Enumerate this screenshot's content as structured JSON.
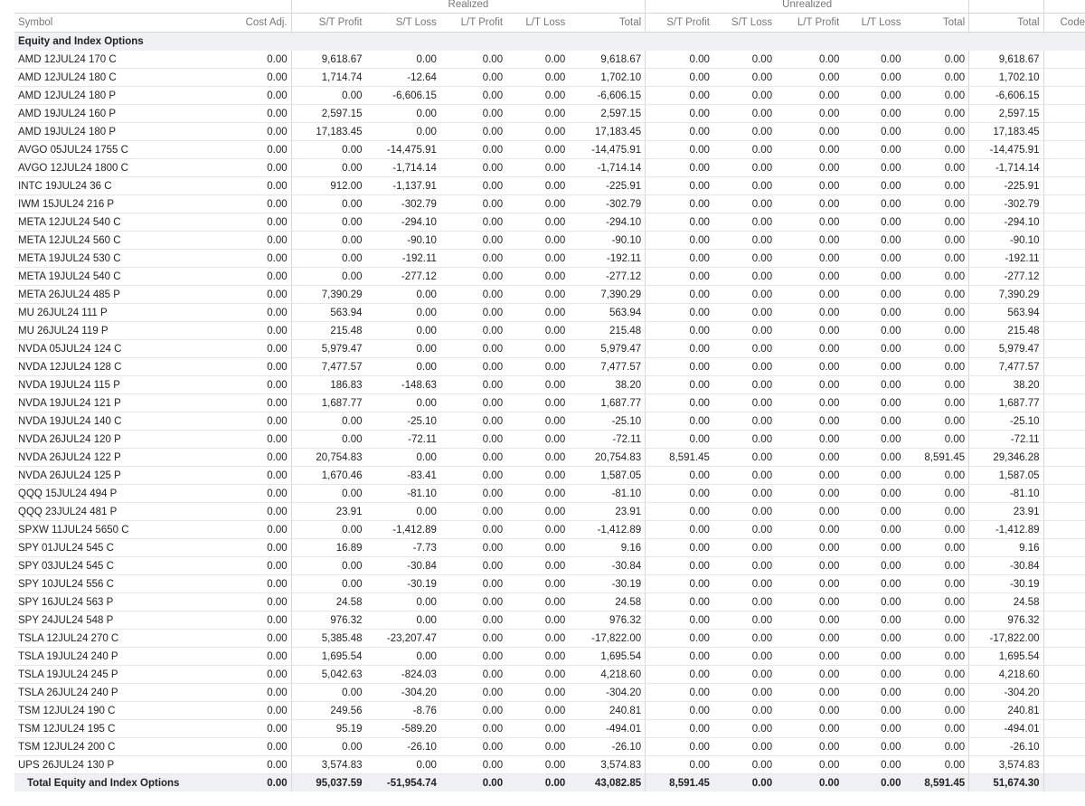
{
  "header": {
    "groups": {
      "realized": "Realized",
      "unrealized": "Unrealized"
    },
    "columns": {
      "symbol": "Symbol",
      "cost_adj": "Cost Adj.",
      "r_st_profit": "S/T Profit",
      "r_st_loss": "S/T Loss",
      "r_lt_profit": "L/T Profit",
      "r_lt_loss": "L/T Loss",
      "r_total": "Total",
      "u_st_profit": "S/T Profit",
      "u_st_loss": "S/T Loss",
      "u_lt_profit": "L/T Profit",
      "u_lt_loss": "L/T Loss",
      "u_total": "Total",
      "total": "Total",
      "code": "Code"
    }
  },
  "section": {
    "title": "Equity and Index Options"
  },
  "rows": [
    {
      "symbol": "AMD 12JUL24 170 C",
      "cost_adj": "0.00",
      "r_st_profit": "9,618.67",
      "r_st_loss": "0.00",
      "r_lt_profit": "0.00",
      "r_lt_loss": "0.00",
      "r_total": "9,618.67",
      "u_st_profit": "0.00",
      "u_st_loss": "0.00",
      "u_lt_profit": "0.00",
      "u_lt_loss": "0.00",
      "u_total": "0.00",
      "total": "9,618.67",
      "code": ""
    },
    {
      "symbol": "AMD 12JUL24 180 C",
      "cost_adj": "0.00",
      "r_st_profit": "1,714.74",
      "r_st_loss": "-12.64",
      "r_lt_profit": "0.00",
      "r_lt_loss": "0.00",
      "r_total": "1,702.10",
      "u_st_profit": "0.00",
      "u_st_loss": "0.00",
      "u_lt_profit": "0.00",
      "u_lt_loss": "0.00",
      "u_total": "0.00",
      "total": "1,702.10",
      "code": ""
    },
    {
      "symbol": "AMD 12JUL24 180 P",
      "cost_adj": "0.00",
      "r_st_profit": "0.00",
      "r_st_loss": "-6,606.15",
      "r_lt_profit": "0.00",
      "r_lt_loss": "0.00",
      "r_total": "-6,606.15",
      "u_st_profit": "0.00",
      "u_st_loss": "0.00",
      "u_lt_profit": "0.00",
      "u_lt_loss": "0.00",
      "u_total": "0.00",
      "total": "-6,606.15",
      "code": ""
    },
    {
      "symbol": "AMD 19JUL24 160 P",
      "cost_adj": "0.00",
      "r_st_profit": "2,597.15",
      "r_st_loss": "0.00",
      "r_lt_profit": "0.00",
      "r_lt_loss": "0.00",
      "r_total": "2,597.15",
      "u_st_profit": "0.00",
      "u_st_loss": "0.00",
      "u_lt_profit": "0.00",
      "u_lt_loss": "0.00",
      "u_total": "0.00",
      "total": "2,597.15",
      "code": ""
    },
    {
      "symbol": "AMD 19JUL24 180 P",
      "cost_adj": "0.00",
      "r_st_profit": "17,183.45",
      "r_st_loss": "0.00",
      "r_lt_profit": "0.00",
      "r_lt_loss": "0.00",
      "r_total": "17,183.45",
      "u_st_profit": "0.00",
      "u_st_loss": "0.00",
      "u_lt_profit": "0.00",
      "u_lt_loss": "0.00",
      "u_total": "0.00",
      "total": "17,183.45",
      "code": ""
    },
    {
      "symbol": "AVGO 05JUL24 1755 C",
      "cost_adj": "0.00",
      "r_st_profit": "0.00",
      "r_st_loss": "-14,475.91",
      "r_lt_profit": "0.00",
      "r_lt_loss": "0.00",
      "r_total": "-14,475.91",
      "u_st_profit": "0.00",
      "u_st_loss": "0.00",
      "u_lt_profit": "0.00",
      "u_lt_loss": "0.00",
      "u_total": "0.00",
      "total": "-14,475.91",
      "code": ""
    },
    {
      "symbol": "AVGO 12JUL24 1800 C",
      "cost_adj": "0.00",
      "r_st_profit": "0.00",
      "r_st_loss": "-1,714.14",
      "r_lt_profit": "0.00",
      "r_lt_loss": "0.00",
      "r_total": "-1,714.14",
      "u_st_profit": "0.00",
      "u_st_loss": "0.00",
      "u_lt_profit": "0.00",
      "u_lt_loss": "0.00",
      "u_total": "0.00",
      "total": "-1,714.14",
      "code": ""
    },
    {
      "symbol": "INTC 19JUL24 36 C",
      "cost_adj": "0.00",
      "r_st_profit": "912.00",
      "r_st_loss": "-1,137.91",
      "r_lt_profit": "0.00",
      "r_lt_loss": "0.00",
      "r_total": "-225.91",
      "u_st_profit": "0.00",
      "u_st_loss": "0.00",
      "u_lt_profit": "0.00",
      "u_lt_loss": "0.00",
      "u_total": "0.00",
      "total": "-225.91",
      "code": ""
    },
    {
      "symbol": "IWM 15JUL24 216 P",
      "cost_adj": "0.00",
      "r_st_profit": "0.00",
      "r_st_loss": "-302.79",
      "r_lt_profit": "0.00",
      "r_lt_loss": "0.00",
      "r_total": "-302.79",
      "u_st_profit": "0.00",
      "u_st_loss": "0.00",
      "u_lt_profit": "0.00",
      "u_lt_loss": "0.00",
      "u_total": "0.00",
      "total": "-302.79",
      "code": ""
    },
    {
      "symbol": "META 12JUL24 540 C",
      "cost_adj": "0.00",
      "r_st_profit": "0.00",
      "r_st_loss": "-294.10",
      "r_lt_profit": "0.00",
      "r_lt_loss": "0.00",
      "r_total": "-294.10",
      "u_st_profit": "0.00",
      "u_st_loss": "0.00",
      "u_lt_profit": "0.00",
      "u_lt_loss": "0.00",
      "u_total": "0.00",
      "total": "-294.10",
      "code": ""
    },
    {
      "symbol": "META 12JUL24 560 C",
      "cost_adj": "0.00",
      "r_st_profit": "0.00",
      "r_st_loss": "-90.10",
      "r_lt_profit": "0.00",
      "r_lt_loss": "0.00",
      "r_total": "-90.10",
      "u_st_profit": "0.00",
      "u_st_loss": "0.00",
      "u_lt_profit": "0.00",
      "u_lt_loss": "0.00",
      "u_total": "0.00",
      "total": "-90.10",
      "code": ""
    },
    {
      "symbol": "META 19JUL24 530 C",
      "cost_adj": "0.00",
      "r_st_profit": "0.00",
      "r_st_loss": "-192.11",
      "r_lt_profit": "0.00",
      "r_lt_loss": "0.00",
      "r_total": "-192.11",
      "u_st_profit": "0.00",
      "u_st_loss": "0.00",
      "u_lt_profit": "0.00",
      "u_lt_loss": "0.00",
      "u_total": "0.00",
      "total": "-192.11",
      "code": ""
    },
    {
      "symbol": "META 19JUL24 540 C",
      "cost_adj": "0.00",
      "r_st_profit": "0.00",
      "r_st_loss": "-277.12",
      "r_lt_profit": "0.00",
      "r_lt_loss": "0.00",
      "r_total": "-277.12",
      "u_st_profit": "0.00",
      "u_st_loss": "0.00",
      "u_lt_profit": "0.00",
      "u_lt_loss": "0.00",
      "u_total": "0.00",
      "total": "-277.12",
      "code": ""
    },
    {
      "symbol": "META 26JUL24 485 P",
      "cost_adj": "0.00",
      "r_st_profit": "7,390.29",
      "r_st_loss": "0.00",
      "r_lt_profit": "0.00",
      "r_lt_loss": "0.00",
      "r_total": "7,390.29",
      "u_st_profit": "0.00",
      "u_st_loss": "0.00",
      "u_lt_profit": "0.00",
      "u_lt_loss": "0.00",
      "u_total": "0.00",
      "total": "7,390.29",
      "code": ""
    },
    {
      "symbol": "MU 26JUL24 111 P",
      "cost_adj": "0.00",
      "r_st_profit": "563.94",
      "r_st_loss": "0.00",
      "r_lt_profit": "0.00",
      "r_lt_loss": "0.00",
      "r_total": "563.94",
      "u_st_profit": "0.00",
      "u_st_loss": "0.00",
      "u_lt_profit": "0.00",
      "u_lt_loss": "0.00",
      "u_total": "0.00",
      "total": "563.94",
      "code": ""
    },
    {
      "symbol": "MU 26JUL24 119 P",
      "cost_adj": "0.00",
      "r_st_profit": "215.48",
      "r_st_loss": "0.00",
      "r_lt_profit": "0.00",
      "r_lt_loss": "0.00",
      "r_total": "215.48",
      "u_st_profit": "0.00",
      "u_st_loss": "0.00",
      "u_lt_profit": "0.00",
      "u_lt_loss": "0.00",
      "u_total": "0.00",
      "total": "215.48",
      "code": ""
    },
    {
      "symbol": "NVDA 05JUL24 124 C",
      "cost_adj": "0.00",
      "r_st_profit": "5,979.47",
      "r_st_loss": "0.00",
      "r_lt_profit": "0.00",
      "r_lt_loss": "0.00",
      "r_total": "5,979.47",
      "u_st_profit": "0.00",
      "u_st_loss": "0.00",
      "u_lt_profit": "0.00",
      "u_lt_loss": "0.00",
      "u_total": "0.00",
      "total": "5,979.47",
      "code": ""
    },
    {
      "symbol": "NVDA 12JUL24 128 C",
      "cost_adj": "0.00",
      "r_st_profit": "7,477.57",
      "r_st_loss": "0.00",
      "r_lt_profit": "0.00",
      "r_lt_loss": "0.00",
      "r_total": "7,477.57",
      "u_st_profit": "0.00",
      "u_st_loss": "0.00",
      "u_lt_profit": "0.00",
      "u_lt_loss": "0.00",
      "u_total": "0.00",
      "total": "7,477.57",
      "code": ""
    },
    {
      "symbol": "NVDA 19JUL24 115 P",
      "cost_adj": "0.00",
      "r_st_profit": "186.83",
      "r_st_loss": "-148.63",
      "r_lt_profit": "0.00",
      "r_lt_loss": "0.00",
      "r_total": "38.20",
      "u_st_profit": "0.00",
      "u_st_loss": "0.00",
      "u_lt_profit": "0.00",
      "u_lt_loss": "0.00",
      "u_total": "0.00",
      "total": "38.20",
      "code": ""
    },
    {
      "symbol": "NVDA 19JUL24 121 P",
      "cost_adj": "0.00",
      "r_st_profit": "1,687.77",
      "r_st_loss": "0.00",
      "r_lt_profit": "0.00",
      "r_lt_loss": "0.00",
      "r_total": "1,687.77",
      "u_st_profit": "0.00",
      "u_st_loss": "0.00",
      "u_lt_profit": "0.00",
      "u_lt_loss": "0.00",
      "u_total": "0.00",
      "total": "1,687.77",
      "code": ""
    },
    {
      "symbol": "NVDA 19JUL24 140 C",
      "cost_adj": "0.00",
      "r_st_profit": "0.00",
      "r_st_loss": "-25.10",
      "r_lt_profit": "0.00",
      "r_lt_loss": "0.00",
      "r_total": "-25.10",
      "u_st_profit": "0.00",
      "u_st_loss": "0.00",
      "u_lt_profit": "0.00",
      "u_lt_loss": "0.00",
      "u_total": "0.00",
      "total": "-25.10",
      "code": ""
    },
    {
      "symbol": "NVDA 26JUL24 120 P",
      "cost_adj": "0.00",
      "r_st_profit": "0.00",
      "r_st_loss": "-72.11",
      "r_lt_profit": "0.00",
      "r_lt_loss": "0.00",
      "r_total": "-72.11",
      "u_st_profit": "0.00",
      "u_st_loss": "0.00",
      "u_lt_profit": "0.00",
      "u_lt_loss": "0.00",
      "u_total": "0.00",
      "total": "-72.11",
      "code": ""
    },
    {
      "symbol": "NVDA 26JUL24 122 P",
      "cost_adj": "0.00",
      "r_st_profit": "20,754.83",
      "r_st_loss": "0.00",
      "r_lt_profit": "0.00",
      "r_lt_loss": "0.00",
      "r_total": "20,754.83",
      "u_st_profit": "8,591.45",
      "u_st_loss": "0.00",
      "u_lt_profit": "0.00",
      "u_lt_loss": "0.00",
      "u_total": "8,591.45",
      "total": "29,346.28",
      "code": ""
    },
    {
      "symbol": "NVDA 26JUL24 125 P",
      "cost_adj": "0.00",
      "r_st_profit": "1,670.46",
      "r_st_loss": "-83.41",
      "r_lt_profit": "0.00",
      "r_lt_loss": "0.00",
      "r_total": "1,587.05",
      "u_st_profit": "0.00",
      "u_st_loss": "0.00",
      "u_lt_profit": "0.00",
      "u_lt_loss": "0.00",
      "u_total": "0.00",
      "total": "1,587.05",
      "code": ""
    },
    {
      "symbol": "QQQ 15JUL24 494 P",
      "cost_adj": "0.00",
      "r_st_profit": "0.00",
      "r_st_loss": "-81.10",
      "r_lt_profit": "0.00",
      "r_lt_loss": "0.00",
      "r_total": "-81.10",
      "u_st_profit": "0.00",
      "u_st_loss": "0.00",
      "u_lt_profit": "0.00",
      "u_lt_loss": "0.00",
      "u_total": "0.00",
      "total": "-81.10",
      "code": ""
    },
    {
      "symbol": "QQQ 23JUL24 481 P",
      "cost_adj": "0.00",
      "r_st_profit": "23.91",
      "r_st_loss": "0.00",
      "r_lt_profit": "0.00",
      "r_lt_loss": "0.00",
      "r_total": "23.91",
      "u_st_profit": "0.00",
      "u_st_loss": "0.00",
      "u_lt_profit": "0.00",
      "u_lt_loss": "0.00",
      "u_total": "0.00",
      "total": "23.91",
      "code": ""
    },
    {
      "symbol": "SPXW 11JUL24 5650 C",
      "cost_adj": "0.00",
      "r_st_profit": "0.00",
      "r_st_loss": "-1,412.89",
      "r_lt_profit": "0.00",
      "r_lt_loss": "0.00",
      "r_total": "-1,412.89",
      "u_st_profit": "0.00",
      "u_st_loss": "0.00",
      "u_lt_profit": "0.00",
      "u_lt_loss": "0.00",
      "u_total": "0.00",
      "total": "-1,412.89",
      "code": ""
    },
    {
      "symbol": "SPY 01JUL24 545 C",
      "cost_adj": "0.00",
      "r_st_profit": "16.89",
      "r_st_loss": "-7.73",
      "r_lt_profit": "0.00",
      "r_lt_loss": "0.00",
      "r_total": "9.16",
      "u_st_profit": "0.00",
      "u_st_loss": "0.00",
      "u_lt_profit": "0.00",
      "u_lt_loss": "0.00",
      "u_total": "0.00",
      "total": "9.16",
      "code": ""
    },
    {
      "symbol": "SPY 03JUL24 545 C",
      "cost_adj": "0.00",
      "r_st_profit": "0.00",
      "r_st_loss": "-30.84",
      "r_lt_profit": "0.00",
      "r_lt_loss": "0.00",
      "r_total": "-30.84",
      "u_st_profit": "0.00",
      "u_st_loss": "0.00",
      "u_lt_profit": "0.00",
      "u_lt_loss": "0.00",
      "u_total": "0.00",
      "total": "-30.84",
      "code": ""
    },
    {
      "symbol": "SPY 10JUL24 556 C",
      "cost_adj": "0.00",
      "r_st_profit": "0.00",
      "r_st_loss": "-30.19",
      "r_lt_profit": "0.00",
      "r_lt_loss": "0.00",
      "r_total": "-30.19",
      "u_st_profit": "0.00",
      "u_st_loss": "0.00",
      "u_lt_profit": "0.00",
      "u_lt_loss": "0.00",
      "u_total": "0.00",
      "total": "-30.19",
      "code": ""
    },
    {
      "symbol": "SPY 16JUL24 563 P",
      "cost_adj": "0.00",
      "r_st_profit": "24.58",
      "r_st_loss": "0.00",
      "r_lt_profit": "0.00",
      "r_lt_loss": "0.00",
      "r_total": "24.58",
      "u_st_profit": "0.00",
      "u_st_loss": "0.00",
      "u_lt_profit": "0.00",
      "u_lt_loss": "0.00",
      "u_total": "0.00",
      "total": "24.58",
      "code": ""
    },
    {
      "symbol": "SPY 24JUL24 548 P",
      "cost_adj": "0.00",
      "r_st_profit": "976.32",
      "r_st_loss": "0.00",
      "r_lt_profit": "0.00",
      "r_lt_loss": "0.00",
      "r_total": "976.32",
      "u_st_profit": "0.00",
      "u_st_loss": "0.00",
      "u_lt_profit": "0.00",
      "u_lt_loss": "0.00",
      "u_total": "0.00",
      "total": "976.32",
      "code": ""
    },
    {
      "symbol": "TSLA 12JUL24 270 C",
      "cost_adj": "0.00",
      "r_st_profit": "5,385.48",
      "r_st_loss": "-23,207.47",
      "r_lt_profit": "0.00",
      "r_lt_loss": "0.00",
      "r_total": "-17,822.00",
      "u_st_profit": "0.00",
      "u_st_loss": "0.00",
      "u_lt_profit": "0.00",
      "u_lt_loss": "0.00",
      "u_total": "0.00",
      "total": "-17,822.00",
      "code": ""
    },
    {
      "symbol": "TSLA 19JUL24 240 P",
      "cost_adj": "0.00",
      "r_st_profit": "1,695.54",
      "r_st_loss": "0.00",
      "r_lt_profit": "0.00",
      "r_lt_loss": "0.00",
      "r_total": "1,695.54",
      "u_st_profit": "0.00",
      "u_st_loss": "0.00",
      "u_lt_profit": "0.00",
      "u_lt_loss": "0.00",
      "u_total": "0.00",
      "total": "1,695.54",
      "code": ""
    },
    {
      "symbol": "TSLA 19JUL24 245 P",
      "cost_adj": "0.00",
      "r_st_profit": "5,042.63",
      "r_st_loss": "-824.03",
      "r_lt_profit": "0.00",
      "r_lt_loss": "0.00",
      "r_total": "4,218.60",
      "u_st_profit": "0.00",
      "u_st_loss": "0.00",
      "u_lt_profit": "0.00",
      "u_lt_loss": "0.00",
      "u_total": "0.00",
      "total": "4,218.60",
      "code": ""
    },
    {
      "symbol": "TSLA 26JUL24 240 P",
      "cost_adj": "0.00",
      "r_st_profit": "0.00",
      "r_st_loss": "-304.20",
      "r_lt_profit": "0.00",
      "r_lt_loss": "0.00",
      "r_total": "-304.20",
      "u_st_profit": "0.00",
      "u_st_loss": "0.00",
      "u_lt_profit": "0.00",
      "u_lt_loss": "0.00",
      "u_total": "0.00",
      "total": "-304.20",
      "code": ""
    },
    {
      "symbol": "TSM 12JUL24 190 C",
      "cost_adj": "0.00",
      "r_st_profit": "249.56",
      "r_st_loss": "-8.76",
      "r_lt_profit": "0.00",
      "r_lt_loss": "0.00",
      "r_total": "240.81",
      "u_st_profit": "0.00",
      "u_st_loss": "0.00",
      "u_lt_profit": "0.00",
      "u_lt_loss": "0.00",
      "u_total": "0.00",
      "total": "240.81",
      "code": ""
    },
    {
      "symbol": "TSM 12JUL24 195 C",
      "cost_adj": "0.00",
      "r_st_profit": "95.19",
      "r_st_loss": "-589.20",
      "r_lt_profit": "0.00",
      "r_lt_loss": "0.00",
      "r_total": "-494.01",
      "u_st_profit": "0.00",
      "u_st_loss": "0.00",
      "u_lt_profit": "0.00",
      "u_lt_loss": "0.00",
      "u_total": "0.00",
      "total": "-494.01",
      "code": ""
    },
    {
      "symbol": "TSM 12JUL24 200 C",
      "cost_adj": "0.00",
      "r_st_profit": "0.00",
      "r_st_loss": "-26.10",
      "r_lt_profit": "0.00",
      "r_lt_loss": "0.00",
      "r_total": "-26.10",
      "u_st_profit": "0.00",
      "u_st_loss": "0.00",
      "u_lt_profit": "0.00",
      "u_lt_loss": "0.00",
      "u_total": "0.00",
      "total": "-26.10",
      "code": ""
    },
    {
      "symbol": "UPS 26JUL24 130 P",
      "cost_adj": "0.00",
      "r_st_profit": "3,574.83",
      "r_st_loss": "0.00",
      "r_lt_profit": "0.00",
      "r_lt_loss": "0.00",
      "r_total": "3,574.83",
      "u_st_profit": "0.00",
      "u_st_loss": "0.00",
      "u_lt_profit": "0.00",
      "u_lt_loss": "0.00",
      "u_total": "0.00",
      "total": "3,574.83",
      "code": ""
    }
  ],
  "total_row": {
    "symbol": "Total Equity and Index Options",
    "cost_adj": "0.00",
    "r_st_profit": "95,037.59",
    "r_st_loss": "-51,954.74",
    "r_lt_profit": "0.00",
    "r_lt_loss": "0.00",
    "r_total": "43,082.85",
    "u_st_profit": "8,591.45",
    "u_st_loss": "0.00",
    "u_lt_profit": "0.00",
    "u_lt_loss": "0.00",
    "u_total": "8,591.45",
    "total": "51,674.30",
    "code": ""
  }
}
